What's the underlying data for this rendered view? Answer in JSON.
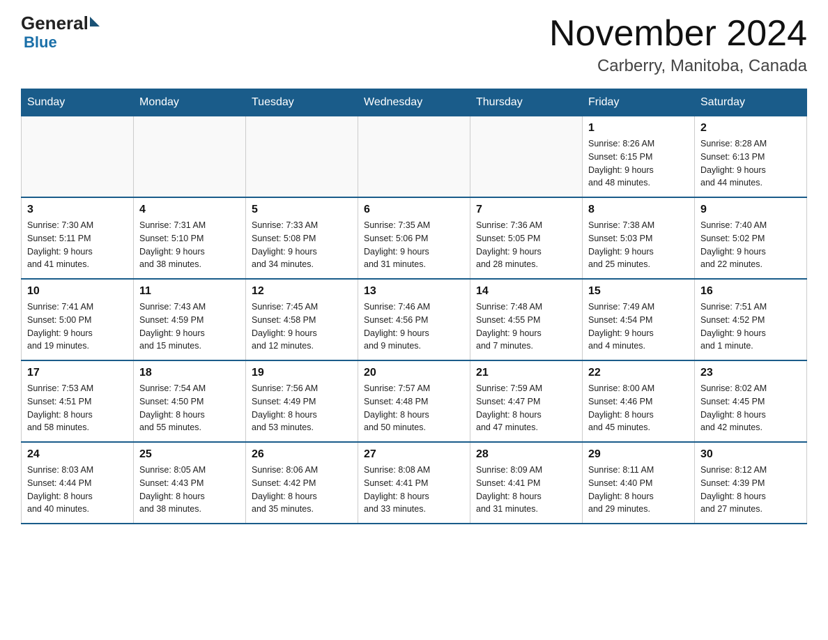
{
  "header": {
    "logo_general": "General",
    "logo_blue": "Blue",
    "month_title": "November 2024",
    "location": "Carberry, Manitoba, Canada"
  },
  "days_of_week": [
    "Sunday",
    "Monday",
    "Tuesday",
    "Wednesday",
    "Thursday",
    "Friday",
    "Saturday"
  ],
  "weeks": [
    [
      {
        "day": "",
        "info": ""
      },
      {
        "day": "",
        "info": ""
      },
      {
        "day": "",
        "info": ""
      },
      {
        "day": "",
        "info": ""
      },
      {
        "day": "",
        "info": ""
      },
      {
        "day": "1",
        "info": "Sunrise: 8:26 AM\nSunset: 6:15 PM\nDaylight: 9 hours\nand 48 minutes."
      },
      {
        "day": "2",
        "info": "Sunrise: 8:28 AM\nSunset: 6:13 PM\nDaylight: 9 hours\nand 44 minutes."
      }
    ],
    [
      {
        "day": "3",
        "info": "Sunrise: 7:30 AM\nSunset: 5:11 PM\nDaylight: 9 hours\nand 41 minutes."
      },
      {
        "day": "4",
        "info": "Sunrise: 7:31 AM\nSunset: 5:10 PM\nDaylight: 9 hours\nand 38 minutes."
      },
      {
        "day": "5",
        "info": "Sunrise: 7:33 AM\nSunset: 5:08 PM\nDaylight: 9 hours\nand 34 minutes."
      },
      {
        "day": "6",
        "info": "Sunrise: 7:35 AM\nSunset: 5:06 PM\nDaylight: 9 hours\nand 31 minutes."
      },
      {
        "day": "7",
        "info": "Sunrise: 7:36 AM\nSunset: 5:05 PM\nDaylight: 9 hours\nand 28 minutes."
      },
      {
        "day": "8",
        "info": "Sunrise: 7:38 AM\nSunset: 5:03 PM\nDaylight: 9 hours\nand 25 minutes."
      },
      {
        "day": "9",
        "info": "Sunrise: 7:40 AM\nSunset: 5:02 PM\nDaylight: 9 hours\nand 22 minutes."
      }
    ],
    [
      {
        "day": "10",
        "info": "Sunrise: 7:41 AM\nSunset: 5:00 PM\nDaylight: 9 hours\nand 19 minutes."
      },
      {
        "day": "11",
        "info": "Sunrise: 7:43 AM\nSunset: 4:59 PM\nDaylight: 9 hours\nand 15 minutes."
      },
      {
        "day": "12",
        "info": "Sunrise: 7:45 AM\nSunset: 4:58 PM\nDaylight: 9 hours\nand 12 minutes."
      },
      {
        "day": "13",
        "info": "Sunrise: 7:46 AM\nSunset: 4:56 PM\nDaylight: 9 hours\nand 9 minutes."
      },
      {
        "day": "14",
        "info": "Sunrise: 7:48 AM\nSunset: 4:55 PM\nDaylight: 9 hours\nand 7 minutes."
      },
      {
        "day": "15",
        "info": "Sunrise: 7:49 AM\nSunset: 4:54 PM\nDaylight: 9 hours\nand 4 minutes."
      },
      {
        "day": "16",
        "info": "Sunrise: 7:51 AM\nSunset: 4:52 PM\nDaylight: 9 hours\nand 1 minute."
      }
    ],
    [
      {
        "day": "17",
        "info": "Sunrise: 7:53 AM\nSunset: 4:51 PM\nDaylight: 8 hours\nand 58 minutes."
      },
      {
        "day": "18",
        "info": "Sunrise: 7:54 AM\nSunset: 4:50 PM\nDaylight: 8 hours\nand 55 minutes."
      },
      {
        "day": "19",
        "info": "Sunrise: 7:56 AM\nSunset: 4:49 PM\nDaylight: 8 hours\nand 53 minutes."
      },
      {
        "day": "20",
        "info": "Sunrise: 7:57 AM\nSunset: 4:48 PM\nDaylight: 8 hours\nand 50 minutes."
      },
      {
        "day": "21",
        "info": "Sunrise: 7:59 AM\nSunset: 4:47 PM\nDaylight: 8 hours\nand 47 minutes."
      },
      {
        "day": "22",
        "info": "Sunrise: 8:00 AM\nSunset: 4:46 PM\nDaylight: 8 hours\nand 45 minutes."
      },
      {
        "day": "23",
        "info": "Sunrise: 8:02 AM\nSunset: 4:45 PM\nDaylight: 8 hours\nand 42 minutes."
      }
    ],
    [
      {
        "day": "24",
        "info": "Sunrise: 8:03 AM\nSunset: 4:44 PM\nDaylight: 8 hours\nand 40 minutes."
      },
      {
        "day": "25",
        "info": "Sunrise: 8:05 AM\nSunset: 4:43 PM\nDaylight: 8 hours\nand 38 minutes."
      },
      {
        "day": "26",
        "info": "Sunrise: 8:06 AM\nSunset: 4:42 PM\nDaylight: 8 hours\nand 35 minutes."
      },
      {
        "day": "27",
        "info": "Sunrise: 8:08 AM\nSunset: 4:41 PM\nDaylight: 8 hours\nand 33 minutes."
      },
      {
        "day": "28",
        "info": "Sunrise: 8:09 AM\nSunset: 4:41 PM\nDaylight: 8 hours\nand 31 minutes."
      },
      {
        "day": "29",
        "info": "Sunrise: 8:11 AM\nSunset: 4:40 PM\nDaylight: 8 hours\nand 29 minutes."
      },
      {
        "day": "30",
        "info": "Sunrise: 8:12 AM\nSunset: 4:39 PM\nDaylight: 8 hours\nand 27 minutes."
      }
    ]
  ]
}
